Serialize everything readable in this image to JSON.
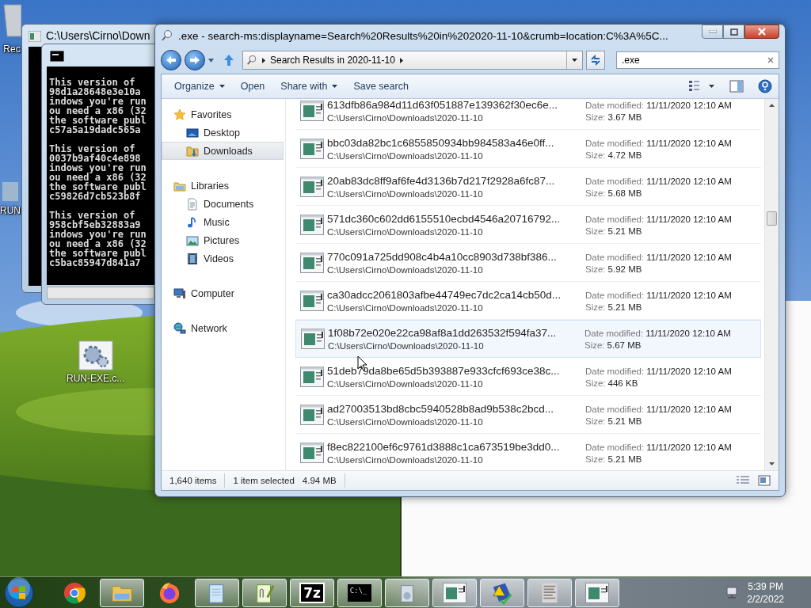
{
  "desktop_icons": [
    {
      "kind": "recycle",
      "label": "Rec"
    },
    {
      "kind": "app",
      "label": "RUN"
    },
    {
      "kind": "gears",
      "label": "RUN-EXE.c..."
    }
  ],
  "console_back": {
    "title": "C:\\Users\\Cirno\\Down"
  },
  "console": {
    "blocks": [
      [
        "This version of",
        "98d1a28648e3e10a",
        "indows you're run",
        "ou need a x86 (32",
        "the software publ",
        "c57a5a19dadc565a"
      ],
      [
        "This version of",
        "0037b9af40c4e898",
        "indows you're run",
        "ou need a x86 (32",
        "the software publ",
        "c59826d7cb523b8f"
      ],
      [
        "This version of",
        "958cbf5eb32883a9",
        "indows you're run",
        "ou need a x86 (32",
        "the software publ",
        "c5bac85947d841a7"
      ]
    ]
  },
  "explorer": {
    "title": ".exe - search-ms:displayname=Search%20Results%20in%202020-11-10&crumb=location:C%3A%5C...",
    "address": {
      "crumb": "Search Results in 2020-11-10"
    },
    "search": {
      "value": ".exe"
    },
    "toolbar": [
      {
        "label": "Organize",
        "dropdown": true
      },
      {
        "label": "Open",
        "dropdown": false
      },
      {
        "label": "Share with",
        "dropdown": true
      },
      {
        "label": "Save search",
        "dropdown": false
      }
    ],
    "nav": [
      {
        "label": "Favorites",
        "kind": "star",
        "selected": false,
        "children": [
          {
            "label": "Desktop",
            "kind": "desktop",
            "selected": false
          },
          {
            "label": "Downloads",
            "kind": "downloads",
            "selected": true
          }
        ]
      },
      {
        "label": "Libraries",
        "kind": "libraries",
        "selected": false,
        "children": [
          {
            "label": "Documents",
            "kind": "documents",
            "selected": false
          },
          {
            "label": "Music",
            "kind": "music",
            "selected": false
          },
          {
            "label": "Pictures",
            "kind": "pictures",
            "selected": false
          },
          {
            "label": "Videos",
            "kind": "videos",
            "selected": false
          }
        ]
      },
      {
        "label": "Computer",
        "kind": "computer",
        "selected": false
      },
      {
        "label": "Network",
        "kind": "network",
        "selected": false
      }
    ],
    "files": [
      {
        "name": "613dfb86a984d11d63f051887e139362f30ec6e...",
        "path": "C:\\Users\\Cirno\\Downloads\\2020-11-10",
        "date_label": "Date modified:",
        "date": "11/11/2020 12:10 AM",
        "size_label": "Size:",
        "size": "3.67 MB",
        "hovered": false
      },
      {
        "name": "bbc03da82bc1c6855850934bb984583a46e0ff...",
        "path": "C:\\Users\\Cirno\\Downloads\\2020-11-10",
        "date_label": "Date modified:",
        "date": "11/11/2020 12:10 AM",
        "size_label": "Size:",
        "size": "4.72 MB",
        "hovered": false
      },
      {
        "name": "20ab83dc8ff9af6fe4d3136b7d217f2928a6fc87...",
        "path": "C:\\Users\\Cirno\\Downloads\\2020-11-10",
        "date_label": "Date modified:",
        "date": "11/11/2020 12:10 AM",
        "size_label": "Size:",
        "size": "5.68 MB",
        "hovered": false
      },
      {
        "name": "571dc360c602dd6155510ecbd4546a20716792...",
        "path": "C:\\Users\\Cirno\\Downloads\\2020-11-10",
        "date_label": "Date modified:",
        "date": "11/11/2020 12:10 AM",
        "size_label": "Size:",
        "size": "5.21 MB",
        "hovered": false
      },
      {
        "name": "770c091a725dd908c4b4a10cc8903d738bf386...",
        "path": "C:\\Users\\Cirno\\Downloads\\2020-11-10",
        "date_label": "Date modified:",
        "date": "11/11/2020 12:10 AM",
        "size_label": "Size:",
        "size": "5.92 MB",
        "hovered": false
      },
      {
        "name": "ca30adcc2061803afbe44749ec7dc2ca14cb50d...",
        "path": "C:\\Users\\Cirno\\Downloads\\2020-11-10",
        "date_label": "Date modified:",
        "date": "11/11/2020 12:10 AM",
        "size_label": "Size:",
        "size": "5.21 MB",
        "hovered": false
      },
      {
        "name": "1f08b72e020e22ca98af8a1dd263532f594fa37...",
        "path": "C:\\Users\\Cirno\\Downloads\\2020-11-10",
        "date_label": "Date modified:",
        "date": "11/11/2020 12:10 AM",
        "size_label": "Size:",
        "size": "5.67 MB",
        "hovered": true
      },
      {
        "name": "51deb79da8be65d5b393887e933cfcf693ce38c...",
        "path": "C:\\Users\\Cirno\\Downloads\\2020-11-10",
        "date_label": "Date modified:",
        "date": "11/11/2020 12:10 AM",
        "size_label": "Size:",
        "size": "446 KB",
        "hovered": false
      },
      {
        "name": "ad27003513bd8cbc5940528b8ad9b538c2bcd...",
        "path": "C:\\Users\\Cirno\\Downloads\\2020-11-10",
        "date_label": "Date modified:",
        "date": "11/11/2020 12:10 AM",
        "size_label": "Size:",
        "size": "5.21 MB",
        "hovered": false
      },
      {
        "name": "f8ec822100ef6c9761d3888c1ca673519be3dd0...",
        "path": "C:\\Users\\Cirno\\Downloads\\2020-11-10",
        "date_label": "Date modified:",
        "date": "11/11/2020 12:10 AM",
        "size_label": "Size:",
        "size": "5.21 MB",
        "hovered": false
      }
    ],
    "status": {
      "count": "1,640 items",
      "selection": "1 item selected",
      "selection_size": "4.94 MB"
    }
  },
  "taskbar": {
    "items": [
      {
        "kind": "start"
      },
      {
        "kind": "chrome",
        "open": false
      },
      {
        "kind": "folder",
        "open": true
      },
      {
        "kind": "firefox",
        "open": false
      },
      {
        "kind": "notepad",
        "open": true
      },
      {
        "kind": "notepadpp",
        "open": true
      },
      {
        "kind": "sevenzip",
        "open": true,
        "label": "7z"
      },
      {
        "kind": "console",
        "open": true,
        "label": "C:\\_"
      },
      {
        "kind": "installer",
        "open": true
      },
      {
        "kind": "window",
        "open": true
      },
      {
        "kind": "warning",
        "open": true
      },
      {
        "kind": "document",
        "open": true
      },
      {
        "kind": "window",
        "open": true
      }
    ],
    "clock": {
      "time": "5:39 PM",
      "date": "2/2/2022"
    }
  }
}
